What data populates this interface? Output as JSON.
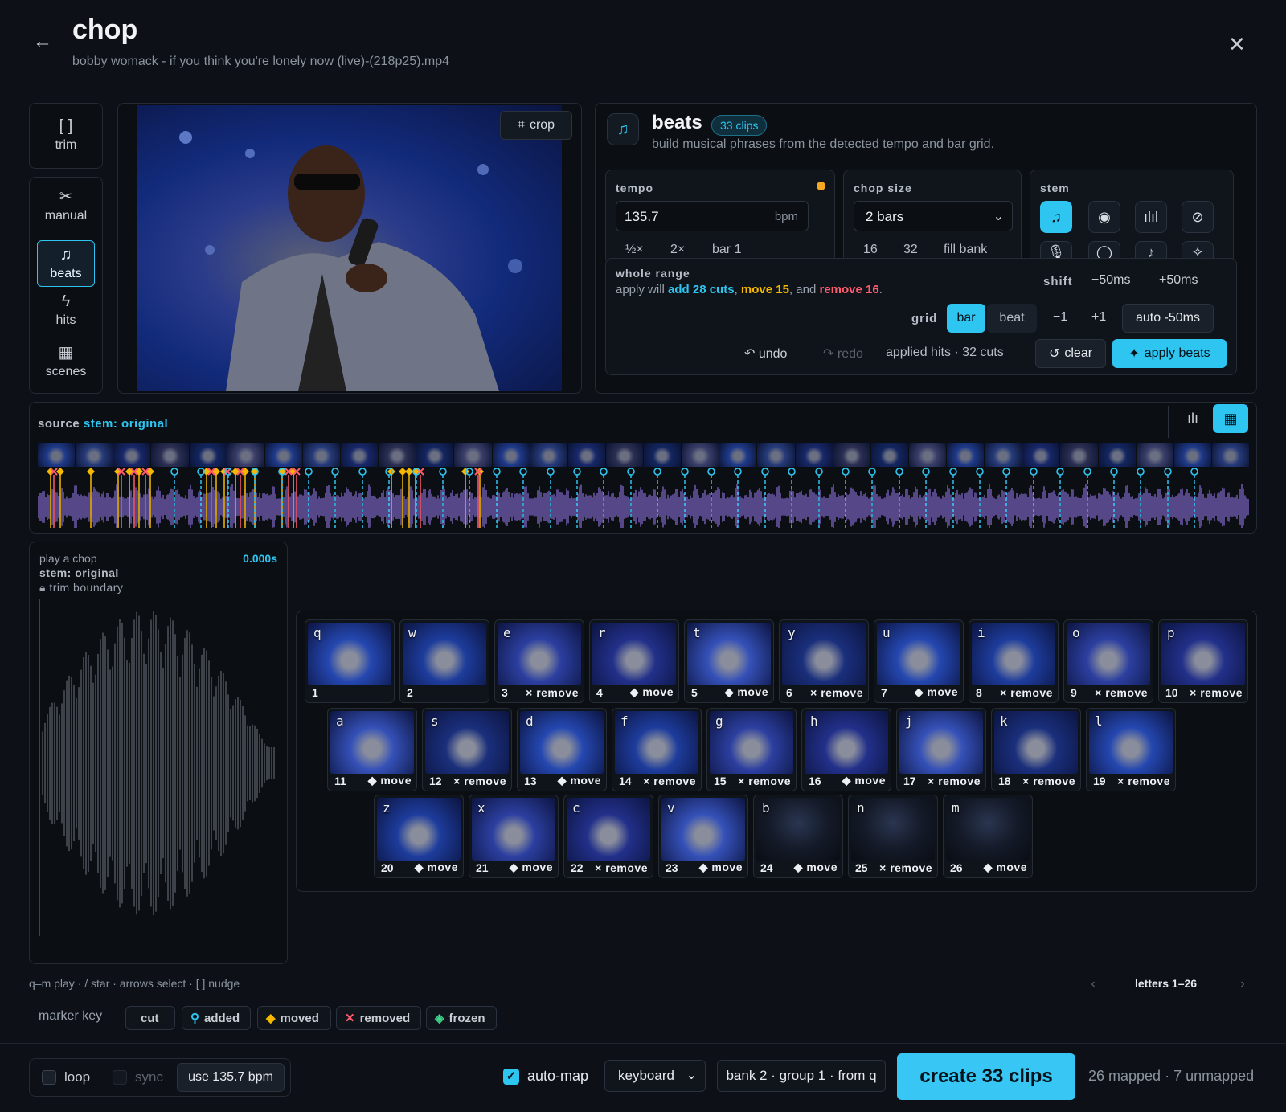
{
  "header": {
    "back_icon": "arrow-left-icon",
    "title": "chop",
    "subtitle": "bobby womack - if you think you're lonely now (live)-(218p25).mp4",
    "close_icon": "close-icon"
  },
  "sidebar": {
    "trim": {
      "icon": "[ ]",
      "label": "trim"
    },
    "manual": {
      "icon": "✂",
      "label": "manual"
    },
    "beats": {
      "icon": "♫",
      "label": "beats"
    },
    "hits": {
      "icon": "ϟ",
      "label": "hits"
    },
    "scenes": {
      "icon": "▦",
      "label": "scenes"
    }
  },
  "video": {
    "crop_label": "crop"
  },
  "beats": {
    "title": "beats",
    "badge": "33 clips",
    "description": "build musical phrases from the detected tempo and bar grid.",
    "tempo": {
      "label": "tempo",
      "value": "135.7",
      "unit": "bpm",
      "half": "½×",
      "double": "2×",
      "bar": "bar 1",
      "indicator_color": "#f5a623"
    },
    "chop_size": {
      "label": "chop size",
      "value": "2 bars",
      "opt16": "16",
      "opt32": "32",
      "fill": "fill bank"
    },
    "stem": {
      "label": "stem"
    },
    "whole_range": {
      "label": "whole range",
      "prefix": "apply will",
      "add": "add 28 cuts",
      "sep1": ",",
      "move": "move 15",
      "sep2": ", and",
      "remove": "remove 16",
      "end": "."
    },
    "shift": {
      "label": "shift",
      "minus": "−50ms",
      "plus": "+50ms"
    },
    "grid": {
      "label": "grid",
      "bar": "bar",
      "beat": "beat",
      "minus1": "−1",
      "plus1": "+1",
      "auto": "auto -50ms"
    },
    "undo": "undo",
    "redo": "redo",
    "applied": "applied hits · 32 cuts",
    "clear": "clear",
    "apply": "apply beats"
  },
  "timeline": {
    "source_label": "source",
    "stem_label": "stem: original"
  },
  "chop": {
    "title": "play a chop",
    "stem": "stem: original",
    "trim": "trim boundary",
    "time": "0.000s"
  },
  "clips": [
    {
      "key": "q",
      "num": "1",
      "status": ""
    },
    {
      "key": "w",
      "num": "2",
      "status": ""
    },
    {
      "key": "e",
      "num": "3",
      "status": "× remove"
    },
    {
      "key": "r",
      "num": "4",
      "status": "◆ move"
    },
    {
      "key": "t",
      "num": "5",
      "status": "◆ move"
    },
    {
      "key": "y",
      "num": "6",
      "status": "× remove"
    },
    {
      "key": "u",
      "num": "7",
      "status": "◆ move"
    },
    {
      "key": "i",
      "num": "8",
      "status": "× remove"
    },
    {
      "key": "o",
      "num": "9",
      "status": "× remove"
    },
    {
      "key": "p",
      "num": "10",
      "status": "× remove"
    },
    {
      "key": "a",
      "num": "11",
      "status": "◆ move"
    },
    {
      "key": "s",
      "num": "12",
      "status": "× remove"
    },
    {
      "key": "d",
      "num": "13",
      "status": "◆ move"
    },
    {
      "key": "f",
      "num": "14",
      "status": "× remove"
    },
    {
      "key": "g",
      "num": "15",
      "status": "× remove"
    },
    {
      "key": "h",
      "num": "16",
      "status": "◆ move"
    },
    {
      "key": "j",
      "num": "17",
      "status": "× remove"
    },
    {
      "key": "k",
      "num": "18",
      "status": "× remove"
    },
    {
      "key": "l",
      "num": "19",
      "status": "× remove"
    },
    {
      "key": "z",
      "num": "20",
      "status": "◆ move"
    },
    {
      "key": "x",
      "num": "21",
      "status": "◆ move"
    },
    {
      "key": "c",
      "num": "22",
      "status": "× remove"
    },
    {
      "key": "v",
      "num": "23",
      "status": "◆ move"
    },
    {
      "key": "b",
      "num": "24",
      "status": "◆ move"
    },
    {
      "key": "n",
      "num": "25",
      "status": "× remove"
    },
    {
      "key": "m",
      "num": "26",
      "status": "◆ move"
    }
  ],
  "hints": "q–m play · / star · arrows select · [ ] nudge",
  "pager": {
    "label": "letters 1–26",
    "prev": "‹",
    "next": "›"
  },
  "marker_key": {
    "label": "marker key",
    "cut": "cut",
    "added": "added",
    "moved": "moved",
    "removed": "removed",
    "frozen": "frozen"
  },
  "footer": {
    "loop": "loop",
    "sync": "sync",
    "use_bpm": "use 135.7 bpm",
    "automap": "auto-map",
    "input": "keyboard",
    "bank": "bank 2 · group 1 · from q",
    "create": "create 33 clips",
    "mapped": "26 mapped · 7 unmapped"
  },
  "colors": {
    "accent": "#2ec5f0",
    "move": "#f5b800",
    "remove": "#ff5a6e",
    "waveform": "#8a6fd6"
  }
}
